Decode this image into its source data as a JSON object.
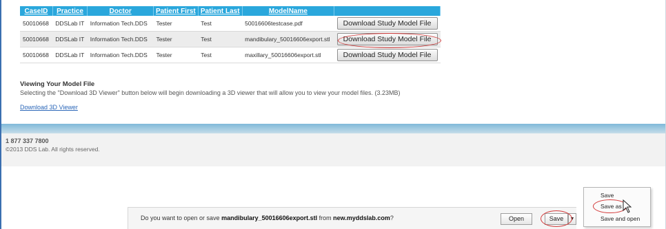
{
  "table": {
    "headers": [
      "CaseID",
      "Practice",
      "Doctor",
      "Patient First",
      "Patient Last",
      "ModelName",
      ""
    ],
    "rows": [
      {
        "case_id": "50010668",
        "practice": "DDSLab IT",
        "doctor": "Information Tech.DDS",
        "first": "Tester",
        "last": "Test",
        "model": "50016606testcase.pdf",
        "button": "Download Study Model File"
      },
      {
        "case_id": "50010668",
        "practice": "DDSLab IT",
        "doctor": "Information Tech.DDS",
        "first": "Tester",
        "last": "Test",
        "model": "mandibulary_50016606export.stl",
        "button": "Download Study Model File"
      },
      {
        "case_id": "50010668",
        "practice": "DDSLab IT",
        "doctor": "Information Tech.DDS",
        "first": "Tester",
        "last": "Test",
        "model": "maxillary_50016606export.stl",
        "button": "Download Study Model File"
      }
    ]
  },
  "viewing": {
    "title": "Viewing Your Model File",
    "description": "Selecting the \"Download 3D Viewer\" button below will begin downloading a 3D viewer that will allow you to view your model files. (3.23MB)",
    "link": "Download 3D Viewer"
  },
  "footer": {
    "phone": "1 877 337 7800",
    "copyright": "©2013 DDS Lab. All rights reserved."
  },
  "download_bar": {
    "prompt_prefix": "Do you want to open or save ",
    "filename": "mandibulary_50016606export.stl",
    "prompt_middle": " from ",
    "site": "new.myddslab.com",
    "prompt_suffix": "?",
    "open": "Open",
    "save": "Save",
    "arrow": "▼"
  },
  "save_menu": {
    "items": [
      "Save",
      "Save as",
      "Save and open"
    ]
  },
  "colors": {
    "header_blue": "#2aa7dc",
    "highlight_red": "#d33a3a",
    "link_blue": "#2a66b8"
  }
}
